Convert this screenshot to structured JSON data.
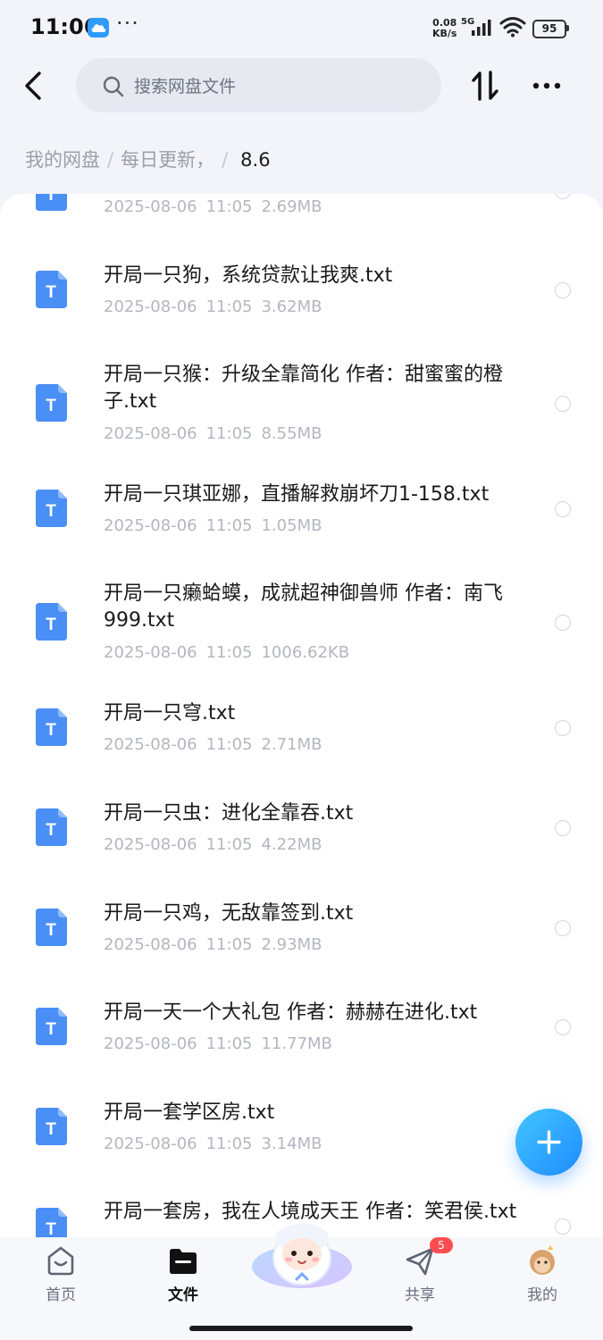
{
  "status_bar": {
    "time": "11:06",
    "more": "···",
    "net_speed_value": "0.08",
    "net_speed_unit": "KB/s",
    "network_type": "5G",
    "battery": "95"
  },
  "header": {
    "search_placeholder": "搜索网盘文件"
  },
  "breadcrumb": {
    "items": [
      "我的网盘",
      "每日更新，",
      "8.6"
    ],
    "separator": "/"
  },
  "files": [
    {
      "name": "",
      "date": "2025-08-06",
      "time": "11:05",
      "size": "2.69MB"
    },
    {
      "name": "开局一只狗，系统贷款让我爽.txt",
      "date": "2025-08-06",
      "time": "11:05",
      "size": "3.62MB"
    },
    {
      "name_line1": "开局一只猴：升级全靠简化 作者：甜蜜蜜的橙",
      "name_line2": "子.txt",
      "date": "2025-08-06",
      "time": "11:05",
      "size": "8.55MB"
    },
    {
      "name": "开局一只琪亚娜，直播解救崩坏刀1-158.txt",
      "date": "2025-08-06",
      "time": "11:05",
      "size": "1.05MB"
    },
    {
      "name_line1": "开局一只癞蛤蟆，成就超神御兽师 作者：南飞",
      "name_line2": "999.txt",
      "date": "2025-08-06",
      "time": "11:05",
      "size": "1006.62KB"
    },
    {
      "name": "开局一只穹.txt",
      "date": "2025-08-06",
      "time": "11:05",
      "size": "2.71MB"
    },
    {
      "name": "开局一只虫：进化全靠吞.txt",
      "date": "2025-08-06",
      "time": "11:05",
      "size": "4.22MB"
    },
    {
      "name": "开局一只鸡，无敌靠签到.txt",
      "date": "2025-08-06",
      "time": "11:05",
      "size": "2.93MB"
    },
    {
      "name": "开局一天一个大礼包 作者：赫赫在进化.txt",
      "date": "2025-08-06",
      "time": "11:05",
      "size": "11.77MB"
    },
    {
      "name": "开局一套学区房.txt",
      "date": "2025-08-06",
      "time": "11:05",
      "size": "3.14MB"
    },
    {
      "name": "开局一套房，我在人境成天王 作者：笑君侯.txt",
      "date": "",
      "time": "",
      "size": ""
    }
  ],
  "bottom_nav": {
    "items": [
      {
        "label": "首页",
        "icon": "home-icon"
      },
      {
        "label": "文件",
        "icon": "folder-icon"
      },
      {
        "label": "共享",
        "icon": "send-icon"
      },
      {
        "label": "我的",
        "icon": "avatar-icon"
      }
    ],
    "share_badge": "5"
  },
  "colors": {
    "accent": "#2f8bff",
    "file_icon": "#4a8ff5",
    "badge": "#ff4d4f"
  }
}
